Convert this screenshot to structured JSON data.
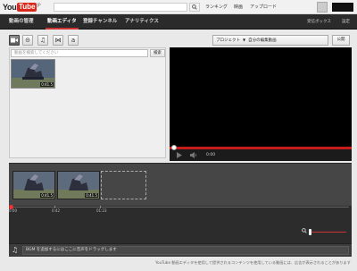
{
  "header": {
    "logo_you": "You",
    "logo_tube": "Tube",
    "logo_region": "JP",
    "search_placeholder": "",
    "links": [
      "ランキング",
      "映画",
      "アップロード"
    ]
  },
  "nav": {
    "tabs": [
      "動画の管理",
      "動画エディタ",
      "登録チャンネル",
      "アナリティクス"
    ],
    "active_tab": "動画エディタ",
    "right_links": [
      "受信ボックス",
      "設定"
    ]
  },
  "toolbar": {
    "tools": [
      "video-camera-icon",
      "transition-icon",
      "music-note-icon",
      "bowtie-transition-icon",
      "text-a-icon"
    ],
    "tool_glyphs": [
      "■",
      "⊝",
      "♫",
      "⋈",
      "a"
    ],
    "active_tool": 0,
    "project_label": "プロジェクト",
    "project_name": "自分の編集動画",
    "publish_label": "公開"
  },
  "clip_panel": {
    "search_placeholder": "動画を検索してください",
    "search_button": "検索",
    "clips": [
      {
        "duration": "0:41.5"
      }
    ]
  },
  "player": {
    "time": "0:00",
    "progress": 0
  },
  "timeline": {
    "clips": [
      {
        "duration": "0:41.5"
      },
      {
        "duration": "0:41.5"
      }
    ],
    "ruler_labels": [
      "0:00",
      "0:42",
      "01:23"
    ]
  },
  "audio": {
    "drop_hint": "BGM を追加するにはここに音声をドラッグします"
  },
  "footer_note": "YouTube 動画エディタを使用して提供されるコンテンツを使用している動画には、広告が表示されることがあります",
  "colors": {
    "brand_red": "#d9291c",
    "nav_bg": "#2b2b2b",
    "progress_red": "#c61b1b"
  }
}
